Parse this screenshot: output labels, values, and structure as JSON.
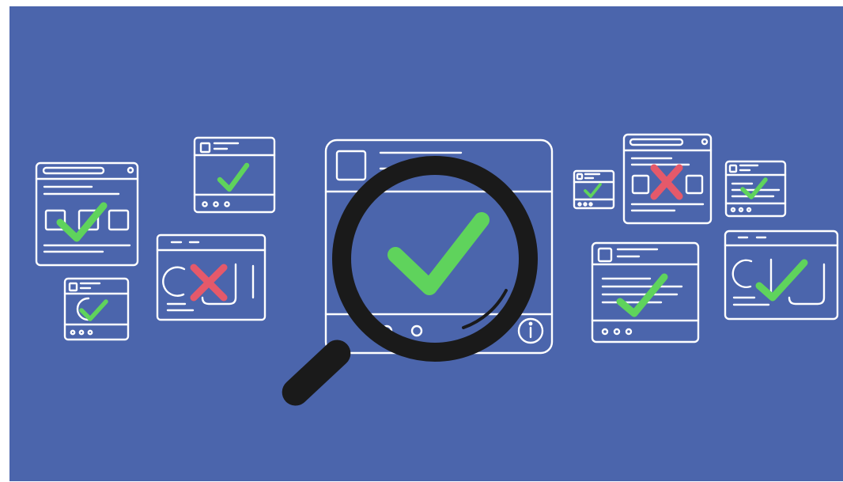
{
  "colors": {
    "page": "#ffffff",
    "background": "#4B65AC",
    "line": "#ffffff",
    "check": "#5FD35C",
    "cross": "#E5596A",
    "magnifier": "#1A1A1A"
  },
  "icons": {
    "focus_card_mark": "check-icon",
    "magnifier": "magnifying-glass-icon",
    "approved_mark": "check-icon",
    "rejected_mark": "x-icon"
  },
  "cards": [
    {
      "id": "card-left-large",
      "status": "approved"
    },
    {
      "id": "card-left-top",
      "status": "approved"
    },
    {
      "id": "card-left-small",
      "status": "approved"
    },
    {
      "id": "card-left-wide",
      "status": "rejected"
    },
    {
      "id": "card-center-main",
      "status": "approved"
    },
    {
      "id": "card-right-tiny",
      "status": "approved"
    },
    {
      "id": "card-right-top",
      "status": "rejected"
    },
    {
      "id": "card-right-small",
      "status": "approved"
    },
    {
      "id": "card-right-mid",
      "status": "approved"
    },
    {
      "id": "card-right-wide",
      "status": "approved"
    }
  ]
}
